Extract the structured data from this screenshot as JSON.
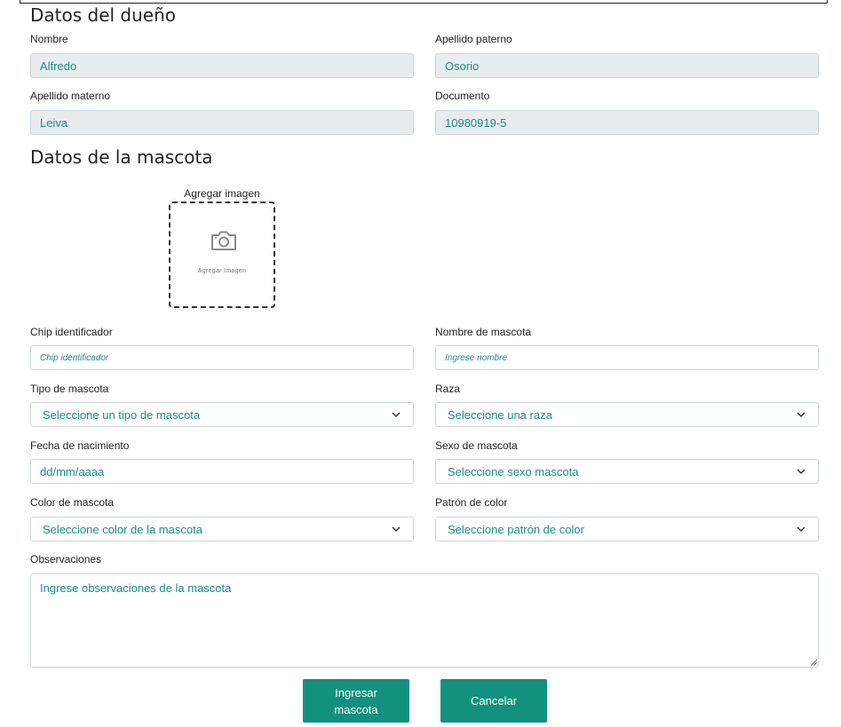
{
  "owner": {
    "title": "Datos del dueño",
    "nombre": {
      "label": "Nombre",
      "value": "Alfredo"
    },
    "apellido_paterno": {
      "label": "Apellido paterno",
      "value": "Osorio"
    },
    "apellido_materno": {
      "label": "Apellido materno",
      "value": "Leiva"
    },
    "documento": {
      "label": "Documento",
      "value": "10980919-5"
    }
  },
  "pet": {
    "title": "Datos de la mascota",
    "image": {
      "label": "Agregar imagen",
      "inner_text": "Agregar Imagen",
      "icon": "camera-icon"
    },
    "chip": {
      "label": "Chip identificador",
      "placeholder": "Chip identificador"
    },
    "nombre": {
      "label": "Nombre de mascota",
      "placeholder": "Ingrese nombre"
    },
    "tipo": {
      "label": "Tipo de mascota",
      "selected": "Seleccione un tipo de mascota"
    },
    "raza": {
      "label": "Raza",
      "selected": "Seleccione una raza"
    },
    "fecha": {
      "label": "Fecha de nacimiento",
      "placeholder": "dd/mm/aaaa"
    },
    "sexo": {
      "label": "Sexo de mascota",
      "selected": "Seleccione sexo mascota"
    },
    "color": {
      "label": "Color de mascota",
      "selected": "Seleccione color de la mascota"
    },
    "patron": {
      "label": "Patrón de color",
      "selected": "Seleccione patrón de color"
    },
    "observaciones": {
      "label": "Observaciones",
      "placeholder": "Ingrese observaciones de la mascota"
    }
  },
  "actions": {
    "submit_label": "Ingresar mascota",
    "cancel_label": "Cancelar"
  },
  "colors": {
    "accent": "#13917f",
    "field_text": "#1e8c7e",
    "readonly_bg": "#e9ecef"
  }
}
